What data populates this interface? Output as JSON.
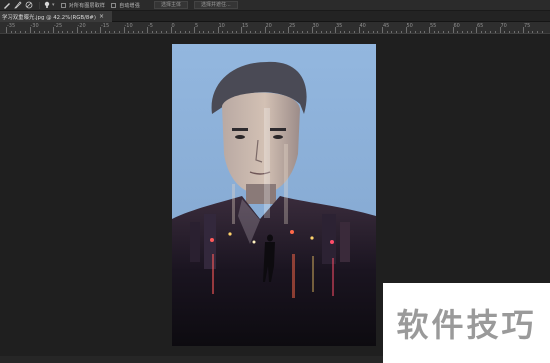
{
  "options_bar": {
    "tools": [
      "brush-icon",
      "pencil-icon",
      "eraser-icon",
      "lightbulb-icon"
    ],
    "sample_all_layers_label": "对所有图层取样",
    "auto_enhance_label": "自动增强",
    "select_subject_label": "选择主体",
    "select_and_mask_label": "选择并遮住..."
  },
  "document": {
    "tab_title": "学习双重曝光.jpg @ 42.2%(RGB/8#)",
    "close_glyph": "×"
  },
  "ruler": {
    "labels": [
      "-35",
      "-30",
      "-25",
      "-20",
      "-15",
      "-10",
      "-5",
      "0",
      "5",
      "10",
      "15",
      "20",
      "25",
      "30",
      "35",
      "40",
      "45",
      "50",
      "55",
      "60",
      "65",
      "70",
      "75",
      "80"
    ]
  },
  "watermark": {
    "text": "软件技巧"
  },
  "colors": {
    "workspace": "#1f1f1f",
    "artwork_background": "#8fb3db",
    "watermark_text": "#9a9a9a"
  }
}
